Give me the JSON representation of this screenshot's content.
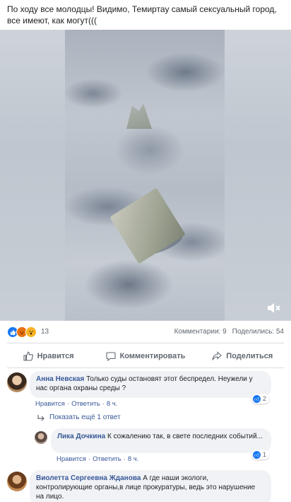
{
  "post": {
    "text": "По ходу все молодцы! Видимо, Темиртау самый сексуальный город, все имеют, как могут((("
  },
  "video": {
    "volume_icon": "volume-icon"
  },
  "reactions": {
    "count": "13",
    "icons": [
      "like-icon",
      "angry-icon",
      "wow-icon"
    ],
    "comments": "Комментарии: 9",
    "shares": "Поделились: 54"
  },
  "actions": {
    "like": "Нравится",
    "comment": "Комментировать",
    "share": "Поделиться"
  },
  "comments": [
    {
      "author": "Анна Невская",
      "text": "Только суды остановят этот беспредел. Неужели у нас органа охраны среды ?",
      "like": "Нравится",
      "reply": "Ответить",
      "time": "8 ч.",
      "reactions": "2"
    },
    {
      "author": "Лика Дочкина",
      "text": "К сожалению так, в свете последних событий...",
      "like": "Нравится",
      "reply": "Ответить",
      "time": "8 ч.",
      "reactions": "1"
    },
    {
      "author": "Виолетта Сергеевна Жданова",
      "text": "А где наши экологи, контролирующие органы,в лице прокуратуры, ведь это нарушение на лицо."
    }
  ],
  "show_replies": "Показать ещё 1 ответ",
  "separator": "·",
  "colors": {
    "link": "#385898",
    "like_blue": "#1877f2",
    "bubble": "#f0f2f5"
  }
}
